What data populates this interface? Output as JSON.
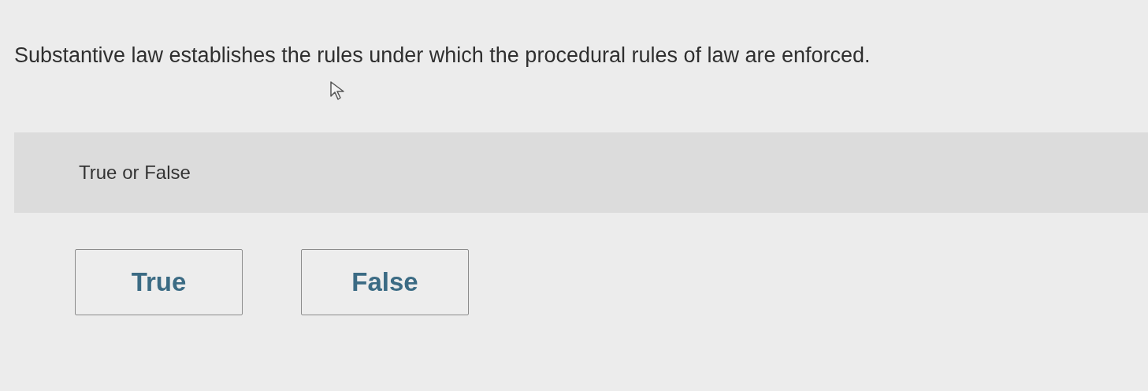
{
  "question": "Substantive law establishes the rules under which the procedural rules of law are enforced.",
  "prompt": "True or False",
  "options": [
    {
      "label": "True"
    },
    {
      "label": "False"
    }
  ]
}
